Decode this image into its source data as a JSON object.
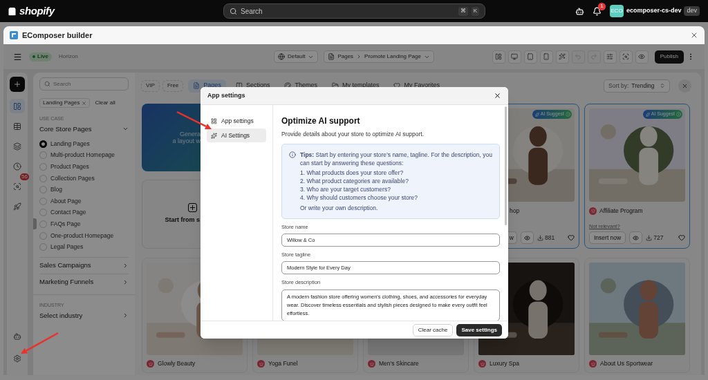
{
  "topbar": {
    "brand": "shopify",
    "search": {
      "placeholder": "Search",
      "keys": [
        "⌘",
        "K"
      ]
    },
    "notification_count": "1",
    "account": {
      "avatar": "ECO",
      "name": "ecomposer-cs-dev",
      "badge": "dev"
    }
  },
  "window": {
    "title": "EComposer builder"
  },
  "toolbar": {
    "status": "Live",
    "theme": "Horizon",
    "locale": "Default",
    "breadcrumb": [
      "Pages",
      "Promote Landing Page"
    ],
    "tools": [
      {
        "kind": "layout",
        "disabled": false
      },
      {
        "kind": "desktop",
        "disabled": false
      },
      {
        "kind": "tablet",
        "disabled": false
      },
      {
        "kind": "mobile",
        "disabled": false
      },
      {
        "kind": "wand",
        "disabled": false
      },
      {
        "kind": "undo",
        "disabled": true
      },
      {
        "kind": "redo",
        "disabled": true
      },
      {
        "kind": "sliders",
        "disabled": false
      },
      {
        "kind": "inspect",
        "disabled": false
      },
      {
        "kind": "preview",
        "disabled": false
      }
    ],
    "publish": "Publish"
  },
  "rail": {
    "items": [
      {
        "kind": "layout",
        "selected": true
      },
      {
        "kind": "table",
        "selected": false
      },
      {
        "kind": "layers",
        "selected": false
      },
      {
        "kind": "history",
        "selected": false
      },
      {
        "kind": "inspect",
        "selected": false,
        "badge": "56"
      },
      {
        "kind": "rocket",
        "selected": false
      }
    ],
    "bottom": [
      {
        "kind": "bot",
        "selected": false
      },
      {
        "kind": "settings",
        "selected": false
      }
    ]
  },
  "sidebar": {
    "search_placeholder": "Search",
    "chip": "Landing Pages",
    "clear": "Clear all",
    "use_case": {
      "label": "USE CASE",
      "value": "Core Store Pages",
      "expanded": true,
      "options": [
        {
          "label": "Landing Pages",
          "selected": true
        },
        {
          "label": "Multi-product Homepage",
          "selected": false
        },
        {
          "label": "Product Pages",
          "selected": false
        },
        {
          "label": "Collection Pages",
          "selected": false
        },
        {
          "label": "Blog",
          "selected": false
        },
        {
          "label": "About Page",
          "selected": false
        },
        {
          "label": "Contact Page",
          "selected": false
        },
        {
          "label": "FAQs Page",
          "selected": false
        },
        {
          "label": "One-product Homepage",
          "selected": false
        },
        {
          "label": "Legal Pages",
          "selected": false
        }
      ]
    },
    "groups": [
      {
        "label": "Sales Campaigns",
        "expanded": false
      },
      {
        "label": "Marketing Funnels",
        "expanded": false
      }
    ],
    "industry": {
      "label": "INDUSTRY",
      "value": "Select industry"
    }
  },
  "filters": {
    "tabs": [
      {
        "label": "VIP",
        "kind": "chip",
        "selected": false
      },
      {
        "label": "Free",
        "kind": "chip",
        "selected": false
      },
      {
        "label": "Pages",
        "kind": "pages",
        "selected": true
      },
      {
        "label": "Sections",
        "kind": "sections",
        "selected": false
      },
      {
        "label": "Themes",
        "kind": "themes",
        "selected": false
      },
      {
        "label": "My templates",
        "kind": "templates",
        "selected": false
      },
      {
        "label": "My Favorites",
        "kind": "favorites",
        "selected": false
      }
    ],
    "sort": {
      "label": "Sort by:",
      "value": "Trending"
    }
  },
  "generate_card": {
    "lines": [
      "Genera",
      "a layout w"
    ]
  },
  "blank_card": {
    "label": "Start from s"
  },
  "suggested": [
    {
      "badge": "AI Suggest",
      "title": "hop",
      "insert": "w",
      "downloads": "881"
    },
    {
      "badge": "AI Suggest",
      "title": "Affiliate Program",
      "note": "Not relevant?",
      "insert": "Insert now",
      "downloads": "727"
    }
  ],
  "templates": [
    {
      "name": "Glowly Beauty"
    },
    {
      "name": "Yoga Funel"
    },
    {
      "name": "Men's Skincare"
    },
    {
      "name": "Luxury Spa"
    },
    {
      "name": "About Us Sportwear"
    }
  ],
  "modal": {
    "title": "App settings",
    "nav": [
      {
        "label": "App settings",
        "kind": "apps",
        "selected": false
      },
      {
        "label": "AI Settings",
        "kind": "ai",
        "selected": true
      }
    ],
    "heading": "Optimize AI support",
    "subtitle": "Provide details about your store to optimize AI support.",
    "tips": {
      "text": "**Tips:** Start by entering your store’s name, tagline. For the description, you can start by answering these questions:",
      "items": [
        "1. What products does your store offer?",
        "2. What product categories are available?",
        "3. Who are your target customers?",
        "4. Why should customers choose your store?"
      ],
      "footer": "Or write your own description."
    },
    "fields": [
      {
        "label": "Store name",
        "value": "Willow & Co",
        "kind": "input"
      },
      {
        "label": "Store tagline",
        "value": "Modern Style for Every Day",
        "kind": "input"
      },
      {
        "label": "Store description",
        "value": "A modern fashion store offering women's clothing, shoes, and accessories for everyday wear. Discover timeless essentials and stylish pieces designed to make every outfit feel effortless.",
        "kind": "textarea"
      }
    ],
    "buttons": [
      {
        "label": "Clear cache",
        "kind": "secondary"
      },
      {
        "label": "Save settings",
        "kind": "primary"
      }
    ]
  }
}
